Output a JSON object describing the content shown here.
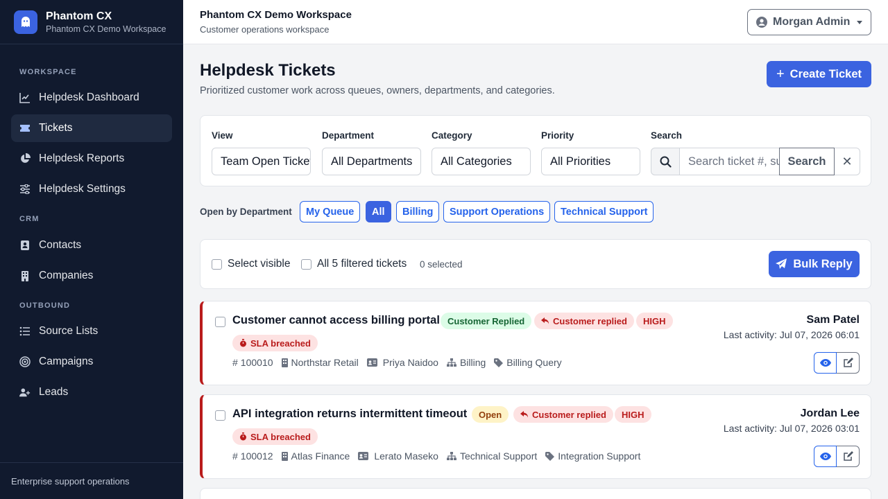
{
  "brand": {
    "name": "Phantom CX",
    "workspace": "Phantom CX Demo Workspace"
  },
  "sidebar": {
    "sections": [
      {
        "label": "WORKSPACE"
      },
      {
        "label": "CRM"
      },
      {
        "label": "OUTBOUND"
      }
    ],
    "items": [
      {
        "label": "Helpdesk Dashboard",
        "icon": "chart-line-icon"
      },
      {
        "label": "Tickets",
        "icon": "ticket-icon",
        "active": true
      },
      {
        "label": "Helpdesk Reports",
        "icon": "pie-chart-icon"
      },
      {
        "label": "Helpdesk Settings",
        "icon": "sliders-icon"
      },
      {
        "label": "Contacts",
        "icon": "contact-card-icon"
      },
      {
        "label": "Companies",
        "icon": "building-icon"
      },
      {
        "label": "Source Lists",
        "icon": "list-icon"
      },
      {
        "label": "Campaigns",
        "icon": "target-icon"
      },
      {
        "label": "Leads",
        "icon": "user-plus-icon"
      }
    ],
    "footer": "Enterprise support operations"
  },
  "header": {
    "title": "Phantom CX Demo Workspace",
    "subtitle": "Customer operations workspace",
    "user": "Morgan Admin"
  },
  "page": {
    "title": "Helpdesk Tickets",
    "subtitle": "Prioritized customer work across queues, owners, departments, and categories.",
    "create_label": "Create Ticket"
  },
  "filters": {
    "view": {
      "label": "View",
      "value": "Team Open Tickets"
    },
    "department": {
      "label": "Department",
      "value": "All Departments"
    },
    "category": {
      "label": "Category",
      "value": "All Categories"
    },
    "priority": {
      "label": "Priority",
      "value": "All Priorities"
    },
    "search": {
      "label": "Search",
      "placeholder": "Search ticket #, subject, customer",
      "button": "Search",
      "clear": "✕"
    }
  },
  "department_tabs": {
    "label": "Open by Department",
    "pills": [
      "My Queue",
      "All",
      "Billing",
      "Support Operations",
      "Technical Support"
    ],
    "active": "All"
  },
  "bulk": {
    "select_visible": "Select visible",
    "select_all": "All 5 filtered tickets",
    "selected": "0 selected",
    "reply_label": "Bulk Reply"
  },
  "tickets": [
    {
      "subject": "Customer cannot access billing portal",
      "status": "Customer Replied",
      "reply": "Customer replied",
      "priority": "HIGH",
      "sla": "SLA breached",
      "number": "100010",
      "company": "Northstar Retail",
      "contact": "Priya Naidoo",
      "department": "Billing",
      "category": "Billing Query",
      "owner": "Sam Patel",
      "activity": "Last activity: Jul 07, 2026 06:01"
    },
    {
      "subject": "API integration returns intermittent timeout",
      "status": "Open",
      "reply": "Customer replied",
      "priority": "HIGH",
      "sla": "SLA breached",
      "number": "100012",
      "company": "Atlas Finance",
      "contact": "Lerato Maseko",
      "department": "Technical Support",
      "category": "Integration Support",
      "owner": "Jordan Lee",
      "activity": "Last activity: Jul 07, 2026 03:01"
    }
  ],
  "colors": {
    "accent": "#3b63e0",
    "sidebar": "#111a2e",
    "sla_border": "#b91c1c"
  }
}
